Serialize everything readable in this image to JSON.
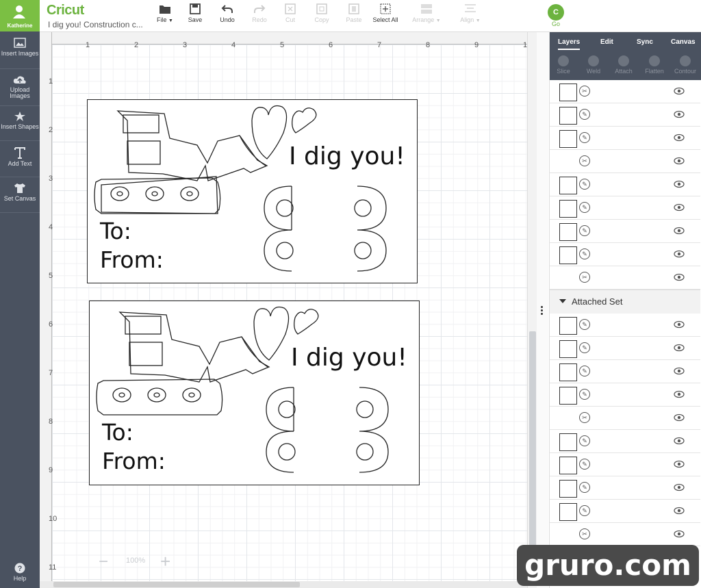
{
  "app": {
    "logo": "Cricut",
    "project_title": "I dig you! Construction c...",
    "user": "Katherine"
  },
  "toolbar": {
    "file": "File",
    "save": "Save",
    "undo": "Undo",
    "redo": "Redo",
    "cut": "Cut",
    "copy": "Copy",
    "paste": "Paste",
    "select_all": "Select All",
    "arrange": "Arrange",
    "align": "Align",
    "go": "Go"
  },
  "sidebar": {
    "items": [
      {
        "label": "Insert Images",
        "icon": "image-icon"
      },
      {
        "label": "Upload Images",
        "icon": "upload-cloud-icon"
      },
      {
        "label": "Insert Shapes",
        "icon": "shapes-icon"
      },
      {
        "label": "Add Text",
        "icon": "text-icon"
      },
      {
        "label": "Set Canvas",
        "icon": "tshirt-icon"
      }
    ],
    "help": "Help"
  },
  "ruler": {
    "top": [
      "1",
      "2",
      "3",
      "4",
      "5",
      "6",
      "7",
      "8",
      "9",
      "1"
    ],
    "left": [
      "1",
      "2",
      "3",
      "4",
      "5",
      "6",
      "7",
      "8",
      "9",
      "10",
      "11"
    ]
  },
  "cards": [
    {
      "headline": "I dig you!",
      "to": "To:",
      "from": "From:"
    },
    {
      "headline": "I dig you!",
      "to": "To:",
      "from": "From:"
    }
  ],
  "zoom": {
    "level": "100%"
  },
  "panel": {
    "tabs": [
      "Layers",
      "Edit",
      "Sync",
      "Canvas"
    ],
    "actions": [
      "Slice",
      "Weld",
      "Attach",
      "Flatten",
      "Contour"
    ],
    "group_title": "Attached Set"
  },
  "watermark": "gruro.com",
  "colors": {
    "brand_green": "#6cb33f",
    "sidebar_bg": "#4a5260"
  }
}
